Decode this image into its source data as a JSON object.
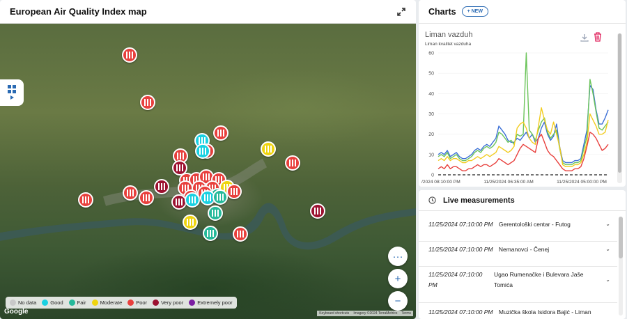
{
  "map": {
    "title": "European Air Quality Index map",
    "legend": [
      {
        "label": "No data",
        "color": "#c9c9c9"
      },
      {
        "label": "Good",
        "color": "#19d1e2"
      },
      {
        "label": "Fair",
        "color": "#25b99a"
      },
      {
        "label": "Moderate",
        "color": "#efd50f"
      },
      {
        "label": "Poor",
        "color": "#e8403d"
      },
      {
        "label": "Very poor",
        "color": "#9c1130"
      },
      {
        "label": "Extremely poor",
        "color": "#7b1fa2"
      }
    ],
    "google_label": "Google",
    "attribution": [
      "Keyboard shortcuts",
      "Imagery ©2024 TerraMetrics",
      "Terms"
    ],
    "more_label": "···",
    "zoom_in_label": "+",
    "zoom_out_label": "−"
  },
  "charts": {
    "title": "Charts",
    "new_button": "+ NEW",
    "card": {
      "name": "Liman vazduh",
      "subtitle": "Liman kvalitet vazduha"
    }
  },
  "chart_data": {
    "type": "line",
    "title": "Liman vazduh",
    "subtitle": "Liman kvalitet vazduha",
    "ylim": [
      0,
      60
    ],
    "y_ticks": [
      "0",
      "10",
      "20",
      "30",
      "40",
      "50",
      "60"
    ],
    "x_ticks": [
      "1/2024 08:10:00 PM",
      "11/25/2024 06:35:00 AM",
      "11/25/2024 05:00:00 PM"
    ],
    "reference_line": {
      "y": 0,
      "style": "dashed"
    },
    "series": [
      {
        "color": "#3b6fd6",
        "values": [
          10,
          11,
          10,
          12,
          9,
          10,
          11,
          9,
          8,
          8,
          9,
          10,
          12,
          13,
          12,
          14,
          15,
          14,
          16,
          18,
          24,
          22,
          20,
          17,
          16,
          16,
          18,
          17,
          19,
          21,
          18,
          20,
          16,
          18,
          23,
          26,
          20,
          17,
          19,
          25,
          14,
          7,
          6,
          6,
          6,
          7,
          7,
          8,
          15,
          22,
          44,
          42,
          32,
          25,
          25,
          28,
          32
        ]
      },
      {
        "color": "#6bc45a",
        "values": [
          9,
          10,
          9,
          11,
          8,
          9,
          10,
          8,
          7,
          7,
          8,
          9,
          11,
          12,
          11,
          13,
          14,
          13,
          14,
          16,
          21,
          20,
          18,
          16,
          17,
          15,
          20,
          19,
          20,
          60,
          22,
          20,
          17,
          22,
          26,
          28,
          21,
          18,
          20,
          22,
          13,
          6,
          5,
          5,
          5,
          6,
          6,
          7,
          13,
          19,
          47,
          40,
          31,
          23,
          22,
          24,
          26
        ]
      },
      {
        "color": "#f2cc1f",
        "values": [
          7,
          8,
          7,
          9,
          7,
          8,
          8,
          7,
          6,
          6,
          7,
          7,
          8,
          9,
          8,
          9,
          10,
          9,
          10,
          11,
          14,
          13,
          12,
          11,
          12,
          14,
          23,
          25,
          26,
          23,
          18,
          16,
          15,
          24,
          33,
          27,
          22,
          20,
          26,
          20,
          14,
          5,
          4,
          4,
          4,
          5,
          5,
          6,
          10,
          16,
          30,
          27,
          24,
          20,
          20,
          21,
          27
        ]
      },
      {
        "color": "#e8403d",
        "values": [
          3,
          4,
          3,
          5,
          3,
          4,
          4,
          3,
          2,
          2,
          3,
          3,
          4,
          5,
          4,
          5,
          5,
          4,
          5,
          6,
          8,
          7,
          6,
          5,
          6,
          7,
          10,
          13,
          15,
          14,
          13,
          12,
          11,
          18,
          20,
          16,
          12,
          10,
          9,
          7,
          5,
          3,
          2,
          2,
          2,
          3,
          3,
          4,
          8,
          14,
          21,
          20,
          18,
          15,
          12,
          13,
          15
        ]
      }
    ]
  },
  "live": {
    "title": "Live measurements",
    "items": [
      {
        "timestamp": "11/25/2024 07:10:00 PM",
        "station": "Gerentološki centar - Futog"
      },
      {
        "timestamp": "11/25/2024 07:10:00 PM",
        "station": "Nemanovci - Čenej"
      },
      {
        "timestamp_line1": "11/25/2024 07:10:00",
        "timestamp_line2": "PM",
        "station_line1": "Ugao Rumenačke i Bulevara Jaše",
        "station_line2": "Tomića"
      },
      {
        "timestamp": "11/25/2024 07:10:00 PM",
        "station": "Muzička škola Isidora Bajić - Liman"
      }
    ]
  }
}
